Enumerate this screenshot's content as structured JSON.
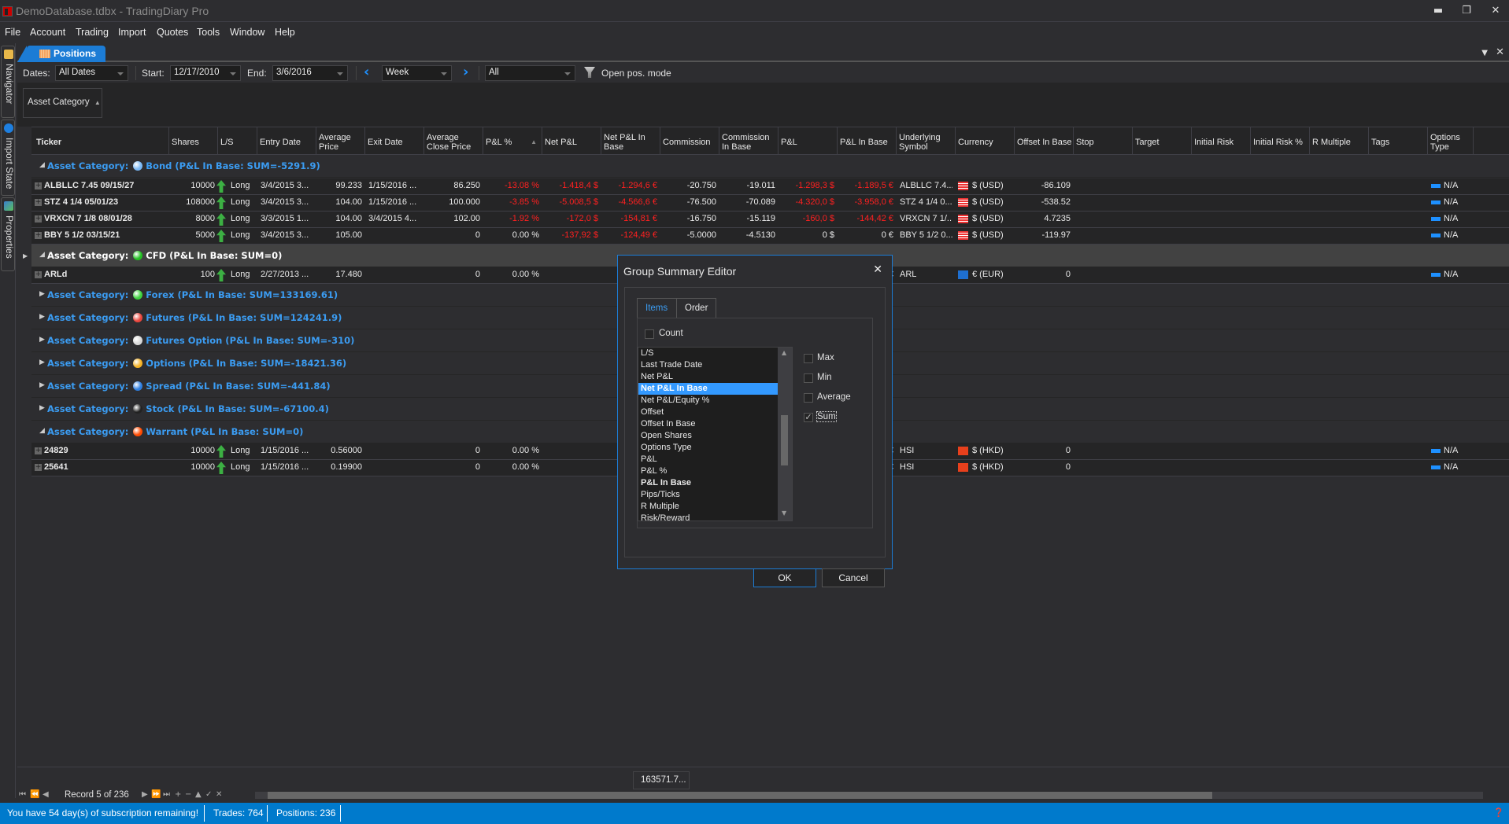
{
  "window": {
    "title": "DemoDatabase.tdbx - TradingDiary Pro"
  },
  "menu": [
    "File",
    "Account",
    "Trading",
    "Import",
    "Quotes",
    "Tools",
    "Window",
    "Help"
  ],
  "dock_tabs": [
    {
      "label": "Navigator",
      "icon": "navigator-icon"
    },
    {
      "label": "Import State",
      "icon": "import-state-icon"
    },
    {
      "label": "Properties",
      "icon": "properties-icon"
    }
  ],
  "document_tab": {
    "label": "Positions"
  },
  "toolbar": {
    "dates_label": "Dates:",
    "dates_value": "All Dates",
    "start_label": "Start:",
    "start_value": "12/17/2010",
    "end_label": "End:",
    "end_value": "3/6/2016",
    "period_value": "Week",
    "filter_value": "All",
    "open_pos_mode_label": "Open pos. mode"
  },
  "group_panel": {
    "chip": "Asset Category"
  },
  "columns": [
    "Ticker",
    "Shares",
    "L/S",
    "Entry Date",
    "Average Price",
    "Exit Date",
    "Average Close Price",
    "P&L %",
    "Net P&L",
    "Net P&L In Base",
    "Commission",
    "Commission In Base",
    "P&L",
    "P&L In Base",
    "Underlying Symbol",
    "Currency",
    "Offset In Base",
    "Stop",
    "Target",
    "Initial Risk",
    "Initial Risk %",
    "R Multiple",
    "Tags",
    "Options Type"
  ],
  "groups": [
    {
      "prefix": "Asset Category:",
      "name": "Bond (P&L In Base: SUM=-5291.9)",
      "color": "#7ab8f5",
      "expanded": true,
      "rows": [
        {
          "ticker": "ALBLLC 7.45 09/15/27",
          "shares": "10000",
          "ls": "Long",
          "entry": "3/4/2015 3...",
          "avg": "99.233",
          "exit": "1/15/2016 ...",
          "close": "86.250",
          "plpct": "-13.08 %",
          "netpl": "-1.418,4 $",
          "netplbase": "-1.294,6 €",
          "comm": "-20.750",
          "commbase": "-19.011",
          "pl": "-1.298,3 $",
          "plbase": "-1.189,5 €",
          "under": "ALBLLC 7.4...",
          "cur": "$ (USD)",
          "flag": "us",
          "offset": "-86.109",
          "opt": "N/A"
        },
        {
          "ticker": "STZ 4 1/4 05/01/23",
          "shares": "108000",
          "ls": "Long",
          "entry": "3/4/2015 3...",
          "avg": "104.00",
          "exit": "1/15/2016 ...",
          "close": "100.000",
          "plpct": "-3.85 %",
          "netpl": "-5.008,5 $",
          "netplbase": "-4.566,6 €",
          "comm": "-76.500",
          "commbase": "-70.089",
          "pl": "-4.320,0 $",
          "plbase": "-3.958,0 €",
          "under": "STZ 4 1/4 0...",
          "cur": "$ (USD)",
          "flag": "us",
          "offset": "-538.52",
          "opt": "N/A"
        },
        {
          "ticker": "VRXCN 7 1/8 08/01/28",
          "shares": "8000",
          "ls": "Long",
          "entry": "3/3/2015 1...",
          "avg": "104.00",
          "exit": "3/4/2015 4...",
          "close": "102.00",
          "plpct": "-1.92 %",
          "netpl": "-172,0 $",
          "netplbase": "-154,81 €",
          "comm": "-16.750",
          "commbase": "-15.119",
          "pl": "-160,0 $",
          "plbase": "-144,42 €",
          "under": "VRXCN 7 1/...",
          "cur": "$ (USD)",
          "flag": "us",
          "offset": "4.7235",
          "opt": "N/A"
        },
        {
          "ticker": "BBY 5 1/2 03/15/21",
          "shares": "5000",
          "ls": "Long",
          "entry": "3/4/2015 3...",
          "avg": "105.00",
          "exit": "",
          "close": "0",
          "plpct": "0.00 %",
          "netpl": "-137,92 $",
          "netplbase": "-124,49 €",
          "comm": "-5.0000",
          "commbase": "-4.5130",
          "pl": "0 $",
          "plbase": "0 €",
          "under": "BBY 5 1/2 0...",
          "cur": "$ (USD)",
          "flag": "us",
          "offset": "-119.97",
          "opt": "N/A"
        }
      ]
    },
    {
      "prefix": "Asset Category:",
      "name": "CFD (P&L In Base: SUM=0)",
      "color": "#22c022",
      "expanded": true,
      "selected": true,
      "rows": [
        {
          "ticker": "ARLd",
          "shares": "100",
          "ls": "Long",
          "entry": "2/27/2013 ...",
          "avg": "17.480",
          "exit": "",
          "close": "0",
          "plpct": "0.00 %",
          "netpl": "",
          "netplbase": "",
          "comm": "",
          "commbase": "",
          "pl": "",
          "plbase": "0 €",
          "under": "ARL",
          "cur": "€ (EUR)",
          "flag": "eu",
          "offset": "0",
          "opt": "N/A"
        }
      ]
    },
    {
      "prefix": "Asset Category:",
      "name": "Forex (P&L In Base: SUM=133169.61)",
      "color": "#3ed23e",
      "expanded": false,
      "rows": []
    },
    {
      "prefix": "Asset Category:",
      "name": "Futures (P&L In Base: SUM=124241.9)",
      "color": "#e8453c",
      "expanded": false,
      "rows": []
    },
    {
      "prefix": "Asset Category:",
      "name": "Futures Option (P&L In Base: SUM=-310)",
      "color": "#d8d8d8",
      "expanded": false,
      "rows": []
    },
    {
      "prefix": "Asset Category:",
      "name": "Options (P&L In Base: SUM=-18421.36)",
      "color": "#f5b225",
      "expanded": false,
      "rows": []
    },
    {
      "prefix": "Asset Category:",
      "name": "Spread (P&L In Base: SUM=-441.84)",
      "color": "#2f7fe0",
      "expanded": false,
      "rows": []
    },
    {
      "prefix": "Asset Category:",
      "name": "Stock (P&L In Base: SUM=-67100.4)",
      "color": "#222222",
      "expanded": false,
      "rows": []
    },
    {
      "prefix": "Asset Category:",
      "name": "Warrant (P&L In Base: SUM=0)",
      "color": "#ff4a00",
      "expanded": true,
      "rows": [
        {
          "ticker": "24829",
          "shares": "10000",
          "ls": "Long",
          "entry": "1/15/2016 ...",
          "avg": "0.56000",
          "exit": "",
          "close": "0",
          "plpct": "0.00 %",
          "netpl": "",
          "netplbase": "",
          "comm": "",
          "commbase": "",
          "pl": "",
          "plbase": "0 €",
          "under": "HSI",
          "cur": "$ (HKD)",
          "flag": "hk",
          "offset": "0",
          "opt": "N/A"
        },
        {
          "ticker": "25641",
          "shares": "10000",
          "ls": "Long",
          "entry": "1/15/2016 ...",
          "avg": "0.19900",
          "exit": "",
          "close": "0",
          "plpct": "0.00 %",
          "netpl": "",
          "netplbase": "",
          "comm": "",
          "commbase": "",
          "pl": "",
          "plbase": "0 €",
          "under": "HSI",
          "cur": "$ (HKD)",
          "flag": "hk",
          "offset": "0",
          "opt": "N/A"
        }
      ]
    }
  ],
  "footer": {
    "summary_value": "163571.7...",
    "record_text": "Record 5 of 236"
  },
  "dialog": {
    "title": "Group Summary Editor",
    "tabs": [
      "Items",
      "Order"
    ],
    "active_tab": "Items",
    "count_label": "Count",
    "list_items": [
      {
        "label": "L/S"
      },
      {
        "label": "Last Trade Date"
      },
      {
        "label": "Net P&L"
      },
      {
        "label": "Net P&L In Base",
        "selected": true,
        "bold": true
      },
      {
        "label": "Net P&L/Equity %"
      },
      {
        "label": "Offset"
      },
      {
        "label": "Offset In Base"
      },
      {
        "label": "Open Shares"
      },
      {
        "label": "Options Type"
      },
      {
        "label": "P&L"
      },
      {
        "label": "P&L  %"
      },
      {
        "label": "P&L In Base",
        "bold": true
      },
      {
        "label": "Pips/Ticks"
      },
      {
        "label": "R Multiple"
      },
      {
        "label": "Risk/Reward"
      }
    ],
    "aggregates": [
      {
        "label": "Max",
        "checked": false
      },
      {
        "label": "Min",
        "checked": false
      },
      {
        "label": "Average",
        "checked": false
      },
      {
        "label": "Sum",
        "checked": true
      }
    ],
    "ok_label": "OK",
    "cancel_label": "Cancel"
  },
  "statusbar": {
    "subscription": "You have 54 day(s) of subscription remaining!",
    "trades": "Trades: 764",
    "positions": "Positions: 236"
  }
}
